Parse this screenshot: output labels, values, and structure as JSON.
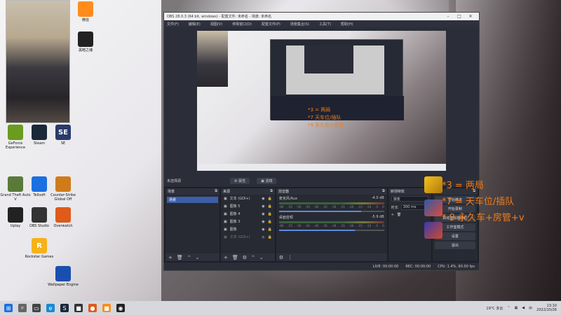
{
  "desktop": {
    "icons": [
      {
        "label": "微信",
        "glyph": "",
        "color": "#ff8c1a"
      },
      {
        "label": "黑暗之魂",
        "glyph": "",
        "color": "#222"
      },
      {
        "label": "GeForce Experience",
        "glyph": "",
        "color": "#6a9c1f"
      },
      {
        "label": "Steam",
        "glyph": "",
        "color": "#1b2838"
      },
      {
        "label": "SE",
        "glyph": "SE",
        "color": "#2a3a6a"
      },
      {
        "label": "Grand Theft Auto V",
        "glyph": "",
        "color": "#5a7a3a"
      },
      {
        "label": "Tellsoft",
        "glyph": "",
        "color": "#1b6fe0"
      },
      {
        "label": "Counter-Strike Global Off",
        "glyph": "",
        "color": "#d07b1a"
      },
      {
        "label": "Uplay",
        "glyph": "",
        "color": "#222"
      },
      {
        "label": "OBS Studio",
        "glyph": "",
        "color": "#333"
      },
      {
        "label": "Overwatch",
        "glyph": "",
        "color": "#e05a1a"
      },
      {
        "label": "Rockstar Games",
        "glyph": "R",
        "color": "#f6b21a"
      },
      {
        "label": "Wallpaper Engine",
        "glyph": "",
        "color": "#1a4fb0"
      }
    ]
  },
  "obs": {
    "title": "OBS 28.0.3 (64 bit, windows) - 配置文件: 未命名 - 场景: 未命名",
    "menu": [
      "文件(F)",
      "编辑(E)",
      "视图(V)",
      "停靠窗口(D)",
      "配置文件(P)",
      "场景集合(S)",
      "工具(T)",
      "帮助(H)"
    ],
    "no_source_label": "未选择源",
    "properties_btn": "属性",
    "filters_btn": "滤镜",
    "scenes": {
      "title": "场景",
      "items": [
        "场景"
      ]
    },
    "sources": {
      "title": "来源",
      "items": [
        {
          "name": "文本 (GDI+)",
          "dim": false
        },
        {
          "name": "图像 5",
          "dim": false
        },
        {
          "name": "图像 4",
          "dim": false
        },
        {
          "name": "图像 3",
          "dim": false
        },
        {
          "name": "图像",
          "dim": false
        },
        {
          "name": "文本 (GDI+)",
          "dim": true
        }
      ]
    },
    "mixer": {
      "title": "混音器",
      "channels": [
        {
          "name": "麦克风/Aux",
          "db": "-4.0 dB",
          "level": 0.78
        },
        {
          "name": "桌面音频",
          "db": "-5.9 dB",
          "level": 0.72
        }
      ],
      "scale": [
        "-60",
        "-55",
        "-50",
        "-45",
        "-40",
        "-35",
        "-30",
        "-25",
        "-20",
        "-15",
        "-10",
        "-5",
        "0"
      ]
    },
    "transitions": {
      "title": "转场特效",
      "type": "渐变",
      "duration_label": "时长",
      "duration": "300 ms"
    },
    "controls": {
      "title": "控件",
      "buttons": [
        "开始推流",
        "开始录制",
        "启动虚拟摄像机",
        "工作室模式",
        "设置",
        "退出"
      ]
    },
    "status": {
      "live": "LIVE: 00:00:00",
      "rec": "REC: 00:00:00",
      "cpu": "CPU: 1.4%, 60.00 fps"
    }
  },
  "overlay": {
    "lines": [
      "*3 = 两局",
      "*7 = 天车位/插队",
      "* 9 永久车+房管+v"
    ]
  },
  "canvas_overlay": {
    "lines": [
      "*3 = 两局",
      "*7 天车位/插队",
      "*9 永久车+房管"
    ]
  },
  "taskbar": {
    "weather": "19°C 多云",
    "time": "13:10",
    "date": "2022/10/26",
    "lang": "中"
  }
}
